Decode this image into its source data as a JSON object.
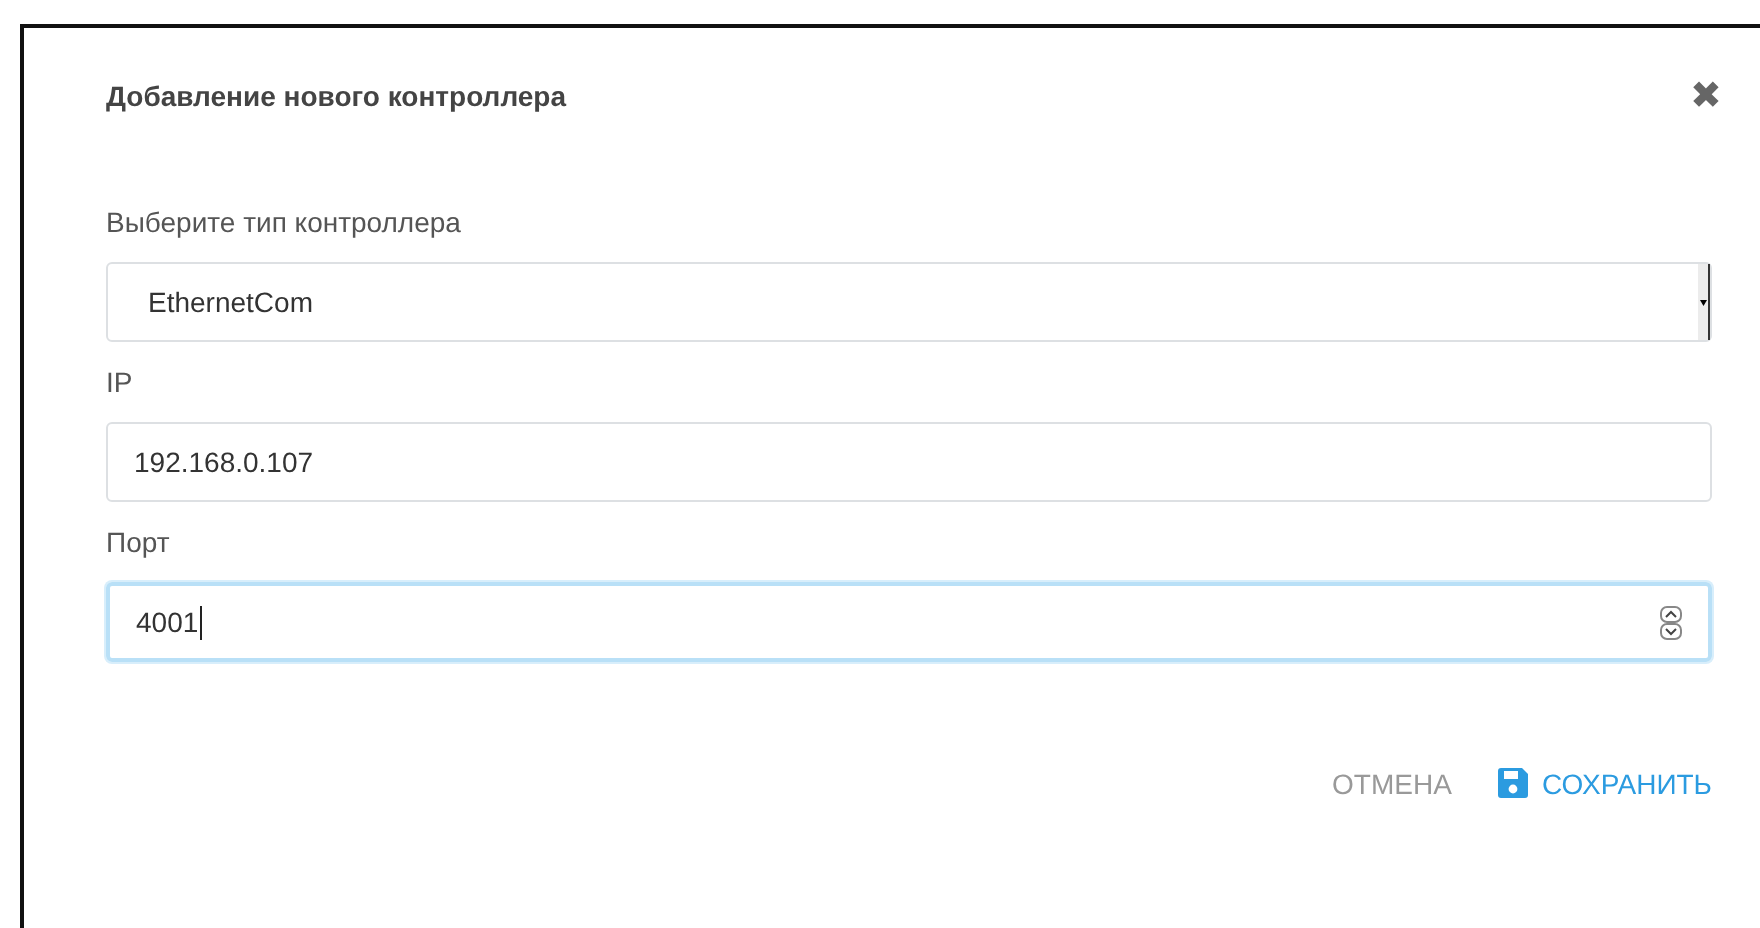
{
  "dialog": {
    "title": "Добавление нового контроллера",
    "close": "✖"
  },
  "fields": [
    {
      "kind": "select",
      "label": "Выберите тип контроллера",
      "value": "EthernetCom",
      "focused": false
    },
    {
      "kind": "text",
      "label": "IP",
      "value": "192.168.0.107",
      "focused": false
    },
    {
      "kind": "number",
      "label": "Порт",
      "value": "4001",
      "focused": true
    }
  ],
  "buttons": [
    {
      "kind": "cancel",
      "label": "ОТМЕНА"
    },
    {
      "kind": "save",
      "label": "СОХРАНИТЬ"
    }
  ]
}
